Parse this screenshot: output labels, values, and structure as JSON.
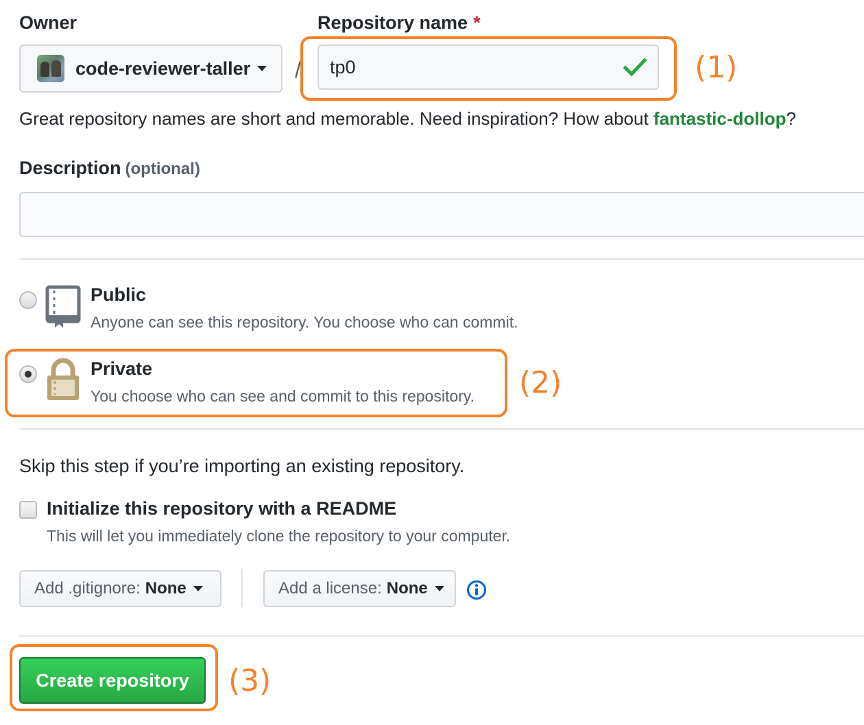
{
  "owner": {
    "label": "Owner",
    "selected": "code-reviewer-taller"
  },
  "separator": "/",
  "repo_name": {
    "label": "Repository name",
    "required_mark": "*",
    "value": "tp0"
  },
  "name_hint": {
    "prefix": "Great repository names are short and memorable. Need inspiration? How about ",
    "suggestion": "fantastic-dollop",
    "suffix": "?"
  },
  "description": {
    "label": "Description",
    "optional": "(optional)",
    "value": ""
  },
  "visibility": {
    "selected": "private",
    "public": {
      "title": "Public",
      "desc": "Anyone can see this repository. You choose who can commit."
    },
    "private": {
      "title": "Private",
      "desc": "You choose who can see and commit to this repository."
    }
  },
  "import_hint": "Skip this step if you’re importing an existing repository.",
  "readme": {
    "checked": false,
    "title": "Initialize this repository with a README",
    "desc": "This will let you immediately clone the repository to your computer."
  },
  "gitignore": {
    "label": "Add .gitignore:",
    "value": "None"
  },
  "license": {
    "label": "Add a license:",
    "value": "None"
  },
  "create_button": "Create repository",
  "annotations": {
    "one": "(1)",
    "two": "(2)",
    "three": "(3)",
    "color": "#f5822a"
  },
  "colors": {
    "primary_button": "#28a745",
    "suggestion_link": "#22863a",
    "check_icon": "#28a745",
    "info_icon": "#0366d6",
    "required_mark": "#cb2431"
  }
}
